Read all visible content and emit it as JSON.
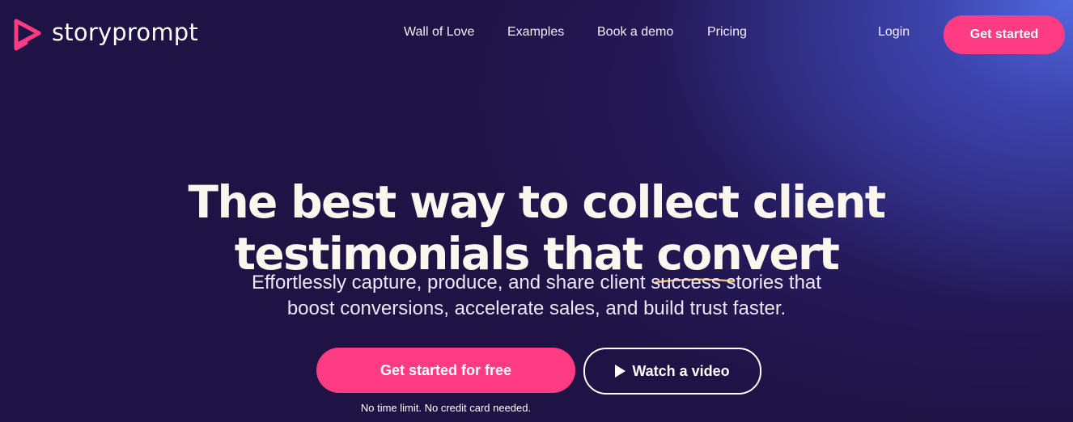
{
  "brand": {
    "name": "storyprompt",
    "accent": "#ff3b84",
    "background": "#1f1244",
    "underline_color": "#f4b860"
  },
  "nav": {
    "items": [
      {
        "label": "Wall of Love"
      },
      {
        "label": "Examples"
      },
      {
        "label": "Book a demo"
      },
      {
        "label": "Pricing"
      }
    ],
    "login_label": "Login",
    "cta_label": "Get started"
  },
  "hero": {
    "title_line1": "The best way to collect client",
    "title_line2_prefix": "testimonials that ",
    "title_highlight": "convert",
    "subtitle_line1": "Effortlessly capture, produce, and share client success stories that",
    "subtitle_line2": "boost conversions, accelerate sales, and build trust faster.",
    "primary_cta": "Get started for free",
    "secondary_cta": "Watch a video",
    "secondary_cta_icon": "play-icon",
    "fineprint": "No time limit. No credit card needed."
  }
}
